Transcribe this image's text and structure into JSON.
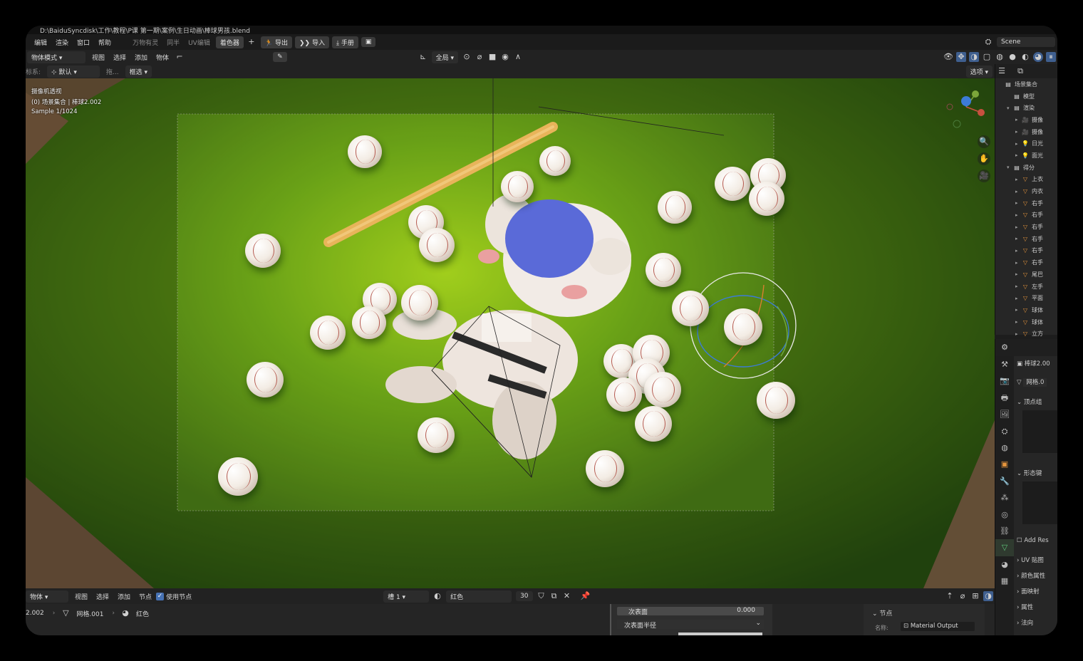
{
  "window_title": "D:\\BaiduSyncdisk\\工作\\教程\\P课 第一期\\案例\\生日动画\\棒球男孩.blend",
  "top_menu": [
    "编辑",
    "渲染",
    "窗口",
    "帮助"
  ],
  "workspace_tabs": [
    "万物有灵",
    "同半",
    "UV编辑",
    "着色器"
  ],
  "active_workspace": "着色器",
  "add_tab_icon": "plus-icon",
  "toolbar_buttons": {
    "export": "导出",
    "import": "导入",
    "manual": "手册"
  },
  "scene_label": "Scene",
  "header2": {
    "mode": "物体模式",
    "menus": [
      "视图",
      "选择",
      "添加",
      "物体"
    ],
    "transform_space": "全局"
  },
  "header3": {
    "coord_label": "标系:",
    "coord_value": "默认",
    "drag_label": "拖...",
    "drag_value": "框选",
    "options_label": "选项"
  },
  "viewport_overlay": {
    "view_name": "摄像机透视",
    "collection_info": "(0) 场景集合 | 棒球2.002",
    "sample": "Sample 1/1024"
  },
  "outliner": {
    "items": [
      {
        "label": "场景集合",
        "icon": "collection-icon",
        "depth": 0
      },
      {
        "label": "模型",
        "icon": "collection-icon",
        "depth": 1
      },
      {
        "label": "渲染",
        "icon": "collection-icon",
        "depth": 1
      },
      {
        "label": "摄像",
        "icon": "camera-icon",
        "depth": 2
      },
      {
        "label": "摄像",
        "icon": "camera-icon",
        "depth": 2
      },
      {
        "label": "日光",
        "icon": "light-icon",
        "depth": 2
      },
      {
        "label": "面光",
        "icon": "light-icon",
        "depth": 2
      },
      {
        "label": "得分",
        "icon": "collection-icon",
        "depth": 1
      },
      {
        "label": "上衣",
        "icon": "mesh-icon",
        "depth": 2
      },
      {
        "label": "内衣",
        "icon": "mesh-icon",
        "depth": 2
      },
      {
        "label": "右手",
        "icon": "mesh-icon",
        "depth": 2
      },
      {
        "label": "右手",
        "icon": "mesh-icon",
        "depth": 2
      },
      {
        "label": "右手",
        "icon": "mesh-icon",
        "depth": 2
      },
      {
        "label": "右手",
        "icon": "mesh-icon",
        "depth": 2
      },
      {
        "label": "右手",
        "icon": "mesh-icon",
        "depth": 2
      },
      {
        "label": "右手",
        "icon": "mesh-icon",
        "depth": 2
      },
      {
        "label": "尾巴",
        "icon": "mesh-icon",
        "depth": 2
      },
      {
        "label": "左手",
        "icon": "mesh-icon",
        "depth": 2
      },
      {
        "label": "平面",
        "icon": "mesh-icon",
        "depth": 2
      },
      {
        "label": "球体",
        "icon": "mesh-icon",
        "depth": 2
      },
      {
        "label": "球体",
        "icon": "mesh-icon",
        "depth": 2
      },
      {
        "label": "立方",
        "icon": "mesh-icon",
        "depth": 2
      },
      {
        "label": "立方",
        "icon": "mesh-icon",
        "depth": 2
      }
    ]
  },
  "properties": {
    "object_name": "棒球2.00",
    "mesh_name": "网格.0",
    "sections": [
      "顶点组",
      "形态键",
      "UV 贴图",
      "颜色属性",
      "面映射",
      "属性",
      "法向"
    ],
    "add_rest": "Add Res"
  },
  "node_header": {
    "mode": "物体",
    "menus": [
      "视图",
      "选择",
      "添加",
      "节点"
    ],
    "use_nodes_label": "使用节点",
    "use_nodes": true,
    "slot": "槽 1",
    "material": "红色",
    "user_count": "30"
  },
  "breadcrumb": [
    "2.002",
    "网格.001",
    "红色"
  ],
  "node_panel": {
    "subsurface_label": "次表面",
    "subsurface_value": "0.000",
    "subsurface_radius_label": "次表面半径",
    "node_section": "节点",
    "name_label": "名称:",
    "name_value": "Material Output"
  },
  "colors": {
    "ui_bg": "#1f1f1f",
    "active_tab": "#3d3d3d",
    "grass": "#5f9a16",
    "cap": "#5a6ad8",
    "bat": "#e8b45a"
  }
}
